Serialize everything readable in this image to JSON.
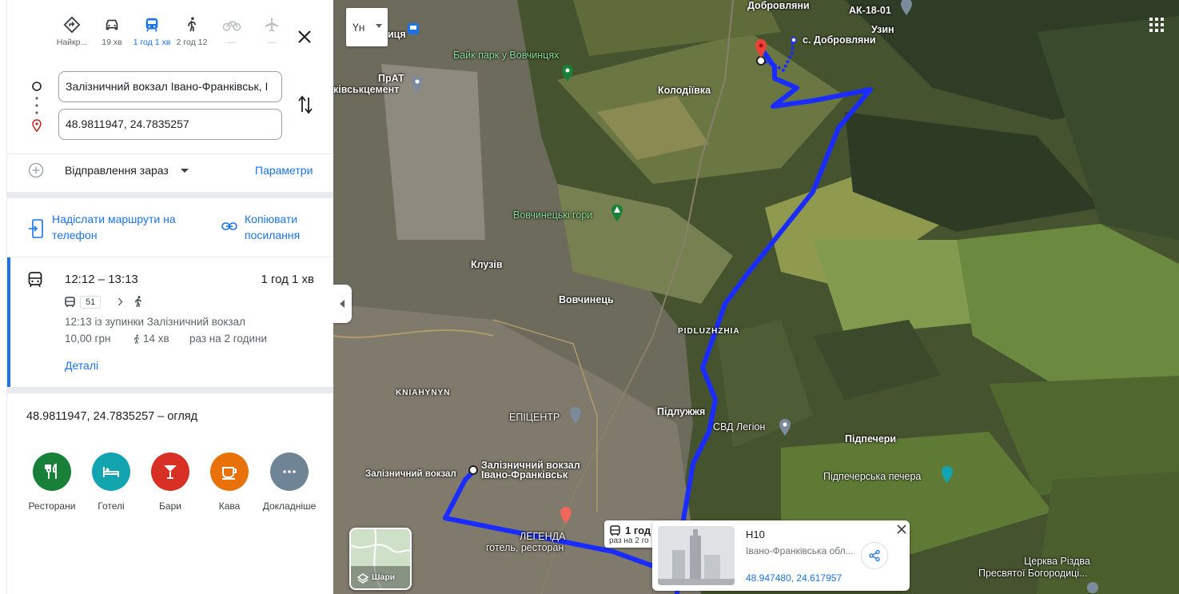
{
  "modes": [
    {
      "label": "Найкр...",
      "icon": "directions-icon",
      "state": "normal"
    },
    {
      "label": "19 хв",
      "icon": "car-icon",
      "state": "normal"
    },
    {
      "label": "1 год 1 хв",
      "icon": "transit-icon",
      "state": "active"
    },
    {
      "label": "2 год 12",
      "icon": "walk-icon",
      "state": "normal"
    },
    {
      "label": "—",
      "icon": "bike-icon",
      "state": "disabled"
    },
    {
      "label": "—",
      "icon": "plane-icon",
      "state": "disabled"
    }
  ],
  "route": {
    "origin": "Залізничний вокзал Івано-Франківськ, І",
    "destination": "48.9811947, 24.7835257"
  },
  "depart": {
    "label": "Відправлення зараз",
    "options_link": "Параметри"
  },
  "share": {
    "send_to_phone": "Надіслати маршрути на телефон",
    "copy_link": "Копіювати посилання"
  },
  "trip": {
    "times": "12:12 – 13:13",
    "duration": "1 год 1 хв",
    "bus_number": "51",
    "from_stop": "12:13 із зупинки Залізничний вокзал",
    "fare": "10,00 грн",
    "walk": "14 хв",
    "frequency": "раз на 2 години",
    "details_link": "Деталі"
  },
  "overview_title": "48.9811947, 24.7835257 – огляд",
  "categories": [
    {
      "label": "Ресторани",
      "color": "#188038",
      "icon": "restaurant-icon"
    },
    {
      "label": "Готелі",
      "color": "#12a4af",
      "icon": "hotel-icon"
    },
    {
      "label": "Бари",
      "color": "#d93025",
      "icon": "bar-icon"
    },
    {
      "label": "Кава",
      "color": "#e8710a",
      "icon": "coffee-icon"
    },
    {
      "label": "Докладніше",
      "color": "#6f8596",
      "icon": "more-icon"
    }
  ],
  "map": {
    "language_button": "Үн",
    "labels": {
      "dobrovliany_top": "Добровляни",
      "ak": "АК-18-01",
      "uzyn": "Узин",
      "s_dobrovliany": "с. Добровляни",
      "vovchyntsia": "иця",
      "bike_park": "Байк парк у Вовчинцях",
      "prat": "ПрАТ",
      "tsement": "ківськцемент",
      "kolodiivka": "Колодіївка",
      "vovchynetski_hory": "Вовчинецькі гори",
      "kluziv": "Клузів",
      "vovchynets": "Вовчинець",
      "pidluzhzhia_en": "PIDLUZHZHIA",
      "knyahynyn": "KNIAHYNYN",
      "epitsentr": "ЕПІЦЕНТР",
      "pidluzhzhia": "Підлужжя",
      "svd": "СВД Легіон",
      "pidpechery": "Підпечери",
      "pidpecherska": "Підпечерська печера",
      "station_small": "Залізничний вокзал",
      "station_big_1": "Залізничний вокзал",
      "station_big_2": "Івано-Франківськ",
      "legenda_1": "ЛЕГЕНДА",
      "legenda_2": "готель, ресторан",
      "church_1": "Церква Різдва",
      "church_2": "Пресвятої Богородиці..."
    },
    "layers_label": "Шари",
    "transit_tip": {
      "duration": "1 год",
      "frequency": "раз на 2 го"
    },
    "place_card": {
      "name": "Н10",
      "region": "Івано-Франківська обл...",
      "coords": "48.947480, 24.617957"
    },
    "route_color": "#1a2cff"
  }
}
